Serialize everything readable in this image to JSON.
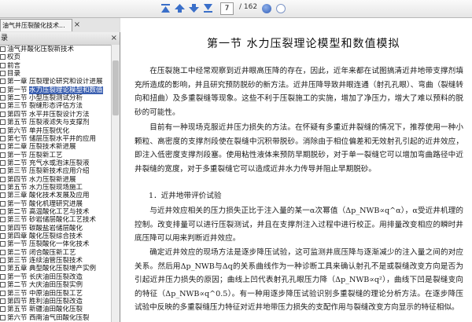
{
  "toolbar": {
    "current_page": "7",
    "total_pages": "/ 162",
    "buttons": [
      "first-page-icon",
      "prev-page-icon",
      "next-page-icon",
      "last-page-icon"
    ],
    "accent": "#3a6fc9"
  },
  "tab": {
    "title": "油气井压裂酸化技术..."
  },
  "sidebar": {
    "header": "录",
    "items": [
      {
        "sec": "",
        "label": "油气井酸化压裂新技术"
      },
      {
        "sec": "",
        "label": "权页"
      },
      {
        "sec": "",
        "label": "前言"
      },
      {
        "sec": "",
        "label": "目录"
      },
      {
        "sec": "第一章",
        "label": "压裂理论研究和设计进展"
      },
      {
        "sec": "第一节",
        "label": "水力压裂理论模型和数值"
      },
      {
        "sec": "第二节",
        "label": "小型压裂测试分析"
      },
      {
        "sec": "第三节",
        "label": "裂缝形态评估方法"
      },
      {
        "sec": "第四节",
        "label": "水平井压裂设计方法"
      },
      {
        "sec": "第五节",
        "label": "压裂液滤失与支撑剂"
      },
      {
        "sec": "第六节",
        "label": "单井压裂优化"
      },
      {
        "sec": "第七节",
        "label": "储层压裂水平井的应用"
      },
      {
        "sec": "第二章",
        "label": "压裂技术新进展"
      },
      {
        "sec": "第一节",
        "label": "压裂新工艺"
      },
      {
        "sec": "第二节",
        "label": "充气水或泡沫压裂液"
      },
      {
        "sec": "第三节",
        "label": "压裂新技术应用介绍"
      },
      {
        "sec": "第四节",
        "label": "水力压裂新进展"
      },
      {
        "sec": "第五节",
        "label": "水力压裂现场施工"
      },
      {
        "sec": "第三章",
        "label": "酸化技术发展及应用"
      },
      {
        "sec": "第一节",
        "label": "酸化机理研究进展"
      },
      {
        "sec": "第二节",
        "label": "高温酸化工艺与技术"
      },
      {
        "sec": "第三节",
        "label": "砂岩储层酸化工艺技术"
      },
      {
        "sec": "第四节",
        "label": "碳酸盐岩储层酸化"
      },
      {
        "sec": "第四章",
        "label": "酸化压裂综合技术"
      },
      {
        "sec": "第一节",
        "label": "压裂酸化一体化技术"
      },
      {
        "sec": "第二节",
        "label": "闭合酸压新工艺"
      },
      {
        "sec": "第三节",
        "label": "连续油管压裂技术"
      },
      {
        "sec": "第五章",
        "label": "典型酸化压裂增产实例"
      },
      {
        "sec": "第一节",
        "label": "长庆油田压裂改造"
      },
      {
        "sec": "第二节",
        "label": "大庆油田压裂实例"
      },
      {
        "sec": "第三节",
        "label": "中原油田压裂工艺"
      },
      {
        "sec": "第四节",
        "label": "胜利油田压裂改造"
      },
      {
        "sec": "第五节",
        "label": "新疆油田酸化压裂"
      },
      {
        "sec": "第六节",
        "label": "西南油气田酸化压裂"
      }
    ]
  },
  "document": {
    "title": "第一节   水力压裂理论模型和数值模拟",
    "para1": "在压裂施工中经常观察到近井眼高压降的存在，因此，近年来都在试图搞清近井地带支撑剂填充所造成的影响，并且研究预防脱砂的新方法。近井压降导致井眼连通（射孔孔眼）、弯曲（裂缝转向和扭曲）及多重裂缝等现象。这些不利于压裂施工的实施，增加了净压力，增大了难以预料的脱砂的可能性。",
    "para2": "目前有一种现场克服近井压力损失的方法。在怀疑有多重近井裂缝的情况下，推荐使用一种小颗粒、高密度的支撑剂段使在裂缝中沉积带脱砂。消除由于相位偏差和无效射孔引起的近井效应，即注入低密度支撑剂段塞。使用粘性液体来预防早期脱砂，对于单一裂缝它可以增加弯曲路径中近井裂缝的宽度，对于多重裂缝它可以造成近井水力传导并阻止早期脱砂。",
    "heading1": "1．近井地带评价试验",
    "para3": "与近井效应相关的压力损失正比于注入量的某一α次幂值（Δp_NWB∝q^α），α受近井机理的控制。改变排量可以进行压裂测试，并且在支撑剂注入过程中进行校正。用排量改变相应的瞬时井底压降可以用来判断近井效应。",
    "para4": "确定近井效应的现场方法是逐步降压试验，这可监测井底压降与逐渐减少的注入量之间的对应关系。然后用Δp_NWB与Δq的关系曲线作为一种诊断工具来确认射孔不是或裂缝改变方向是否为引起近井压力损失的原因；曲线上凹代表射孔孔眼压力降（Δp_NWB∝q²），曲线下凹是裂缝变向的特征（Δp_NWB∝q^0.5）。有一种用逐步降压试验识别多重裂缝的理论分析方法。在逐步降压试验中反映的多重裂缝压力特征对近井地带压力损失的支配作用与裂缝改变方向显示的特征相似。"
  }
}
